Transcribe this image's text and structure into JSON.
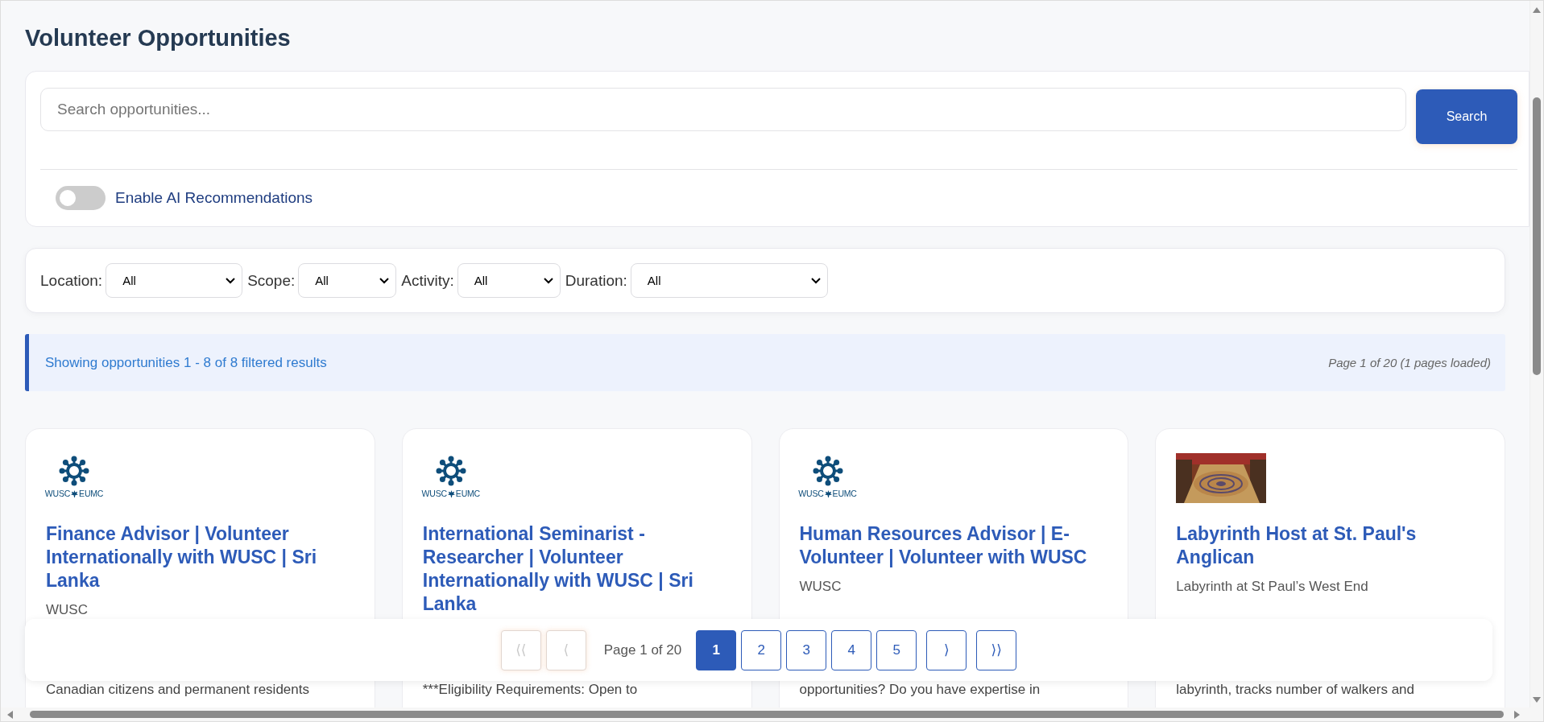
{
  "page_title": "Volunteer Opportunities",
  "search": {
    "placeholder": "Search opportunities...",
    "button": "Search"
  },
  "ai_toggle": {
    "label": "Enable AI Recommendations",
    "on": false
  },
  "filters": [
    {
      "label": "Location:",
      "value": "All"
    },
    {
      "label": "Scope:",
      "value": "All"
    },
    {
      "label": "Activity:",
      "value": "All"
    },
    {
      "label": "Duration:",
      "value": "All"
    }
  ],
  "results_info": {
    "summary": "Showing opportunities 1 - 8 of 8 filtered results",
    "page_info": "Page 1 of 20 (1 pages loaded)"
  },
  "cards": [
    {
      "image": {
        "kind": "logo",
        "left": "WUSC",
        "right": "EUMC"
      },
      "title": "Finance Advisor | Volunteer Internationally with WUSC | Sri Lanka",
      "organization": "WUSC",
      "description": "Canadian citizens and permanent residents"
    },
    {
      "image": {
        "kind": "logo",
        "left": "WUSC",
        "right": "EUMC"
      },
      "title": "International Seminarist - Researcher | Volunteer Internationally with WUSC | Sri Lanka",
      "description": "***Eligibility Requirements: Open to"
    },
    {
      "image": {
        "kind": "logo",
        "left": "WUSC",
        "right": "EUMC"
      },
      "title": "Human Resources Advisor | E-Volunteer | Volunteer with WUSC",
      "organization": "WUSC",
      "description": "opportunities? Do you have expertise in"
    },
    {
      "title": "Labyrinth Host at St. Paul's Anglican",
      "organization": "Labyrinth at St Paul’s West End",
      "description": "labyrinth, tracks number of walkers and"
    }
  ],
  "pagination": {
    "first": {
      "label": "⟨⟨",
      "disabled": true
    },
    "prev": {
      "label": "⟨",
      "disabled": true
    },
    "status": "Page 1 of 20",
    "pages": [
      {
        "label": "1",
        "selected": true
      },
      {
        "label": "2",
        "selected": false
      },
      {
        "label": "3",
        "selected": false
      },
      {
        "label": "4",
        "selected": false
      },
      {
        "label": "5",
        "selected": false
      }
    ],
    "next": {
      "label": "⟩",
      "disabled": false
    },
    "last": {
      "label": "⟩⟩",
      "disabled": false
    }
  }
}
